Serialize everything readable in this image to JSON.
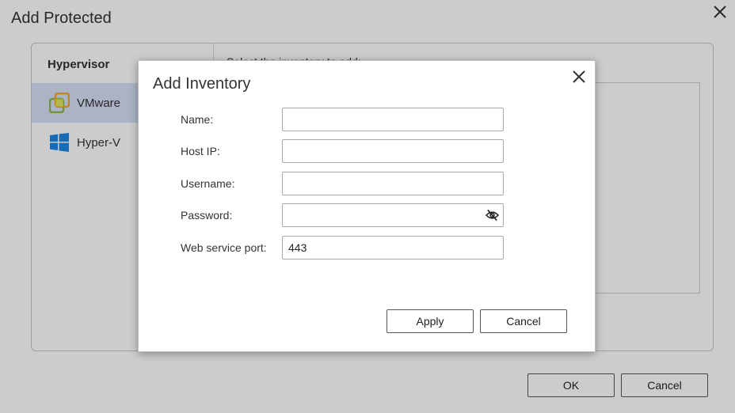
{
  "background": {
    "title": "Add Protected",
    "sidebar": {
      "header": "Hypervisor",
      "items": [
        {
          "label": "VMware",
          "icon": "vmware-icon",
          "selected": true
        },
        {
          "label": "Hyper-V",
          "icon": "windows-icon",
          "selected": false
        }
      ]
    },
    "main_text": "Select the inventory to add:",
    "buttons": {
      "ok": "OK",
      "cancel": "Cancel"
    }
  },
  "dialog": {
    "title": "Add Inventory",
    "fields": {
      "name": {
        "label": "Name:",
        "value": ""
      },
      "host_ip": {
        "label": "Host IP:",
        "value": ""
      },
      "username": {
        "label": "Username:",
        "value": ""
      },
      "password": {
        "label": "Password:",
        "value": ""
      },
      "port": {
        "label": "Web service port:",
        "value": "443"
      }
    },
    "buttons": {
      "apply": "Apply",
      "cancel": "Cancel"
    }
  },
  "colors": {
    "selected_bg": "#d6e0f7",
    "vmware_green": "#8bb73f",
    "vmware_orange": "#f5a623",
    "windows_blue": "#1e88e5"
  }
}
